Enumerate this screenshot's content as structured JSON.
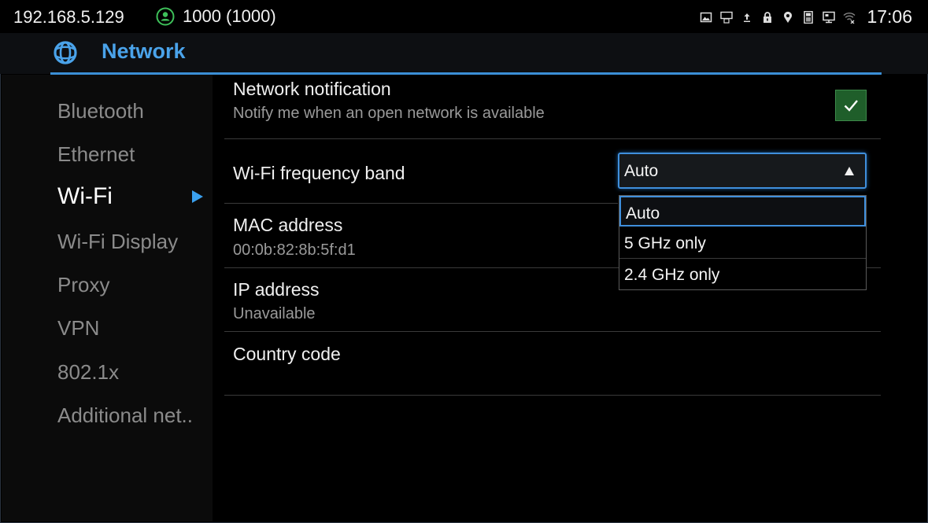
{
  "status_bar": {
    "ip": "192.168.5.129",
    "account": "1000 (1000)",
    "time": "17:06",
    "icons": [
      "image-icon",
      "network-share-icon",
      "upload-icon",
      "lock-icon",
      "location-icon",
      "phone-icon",
      "display-icon",
      "wifi-icon"
    ]
  },
  "header": {
    "title": "Network",
    "icon": "globe-icon",
    "accent": "#4aa3ea"
  },
  "sidebar": {
    "items": [
      {
        "label": "Bluetooth"
      },
      {
        "label": "Ethernet"
      },
      {
        "label": "Wi-Fi",
        "active": true
      },
      {
        "label": "Wi-Fi Display"
      },
      {
        "label": "Proxy"
      },
      {
        "label": "VPN"
      },
      {
        "label": "802.1x"
      },
      {
        "label": "Additional net.."
      }
    ]
  },
  "settings": {
    "network_notification": {
      "title": "Network notification",
      "summary": "Notify me when an open network is available",
      "checked": true
    },
    "frequency_band": {
      "title": "Wi-Fi frequency band",
      "value": "Auto",
      "options": [
        "Auto",
        "5 GHz only",
        "2.4 GHz only"
      ],
      "selected_index": 0
    },
    "mac": {
      "title": "MAC address",
      "value": "00:0b:82:8b:5f:d1"
    },
    "ip": {
      "title": "IP address",
      "value": "Unavailable"
    },
    "country": {
      "title": "Country code"
    }
  },
  "colors": {
    "accent": "#3f8fdc",
    "check_bg": "#1f5e2a",
    "account_green": "#3ec15a"
  }
}
